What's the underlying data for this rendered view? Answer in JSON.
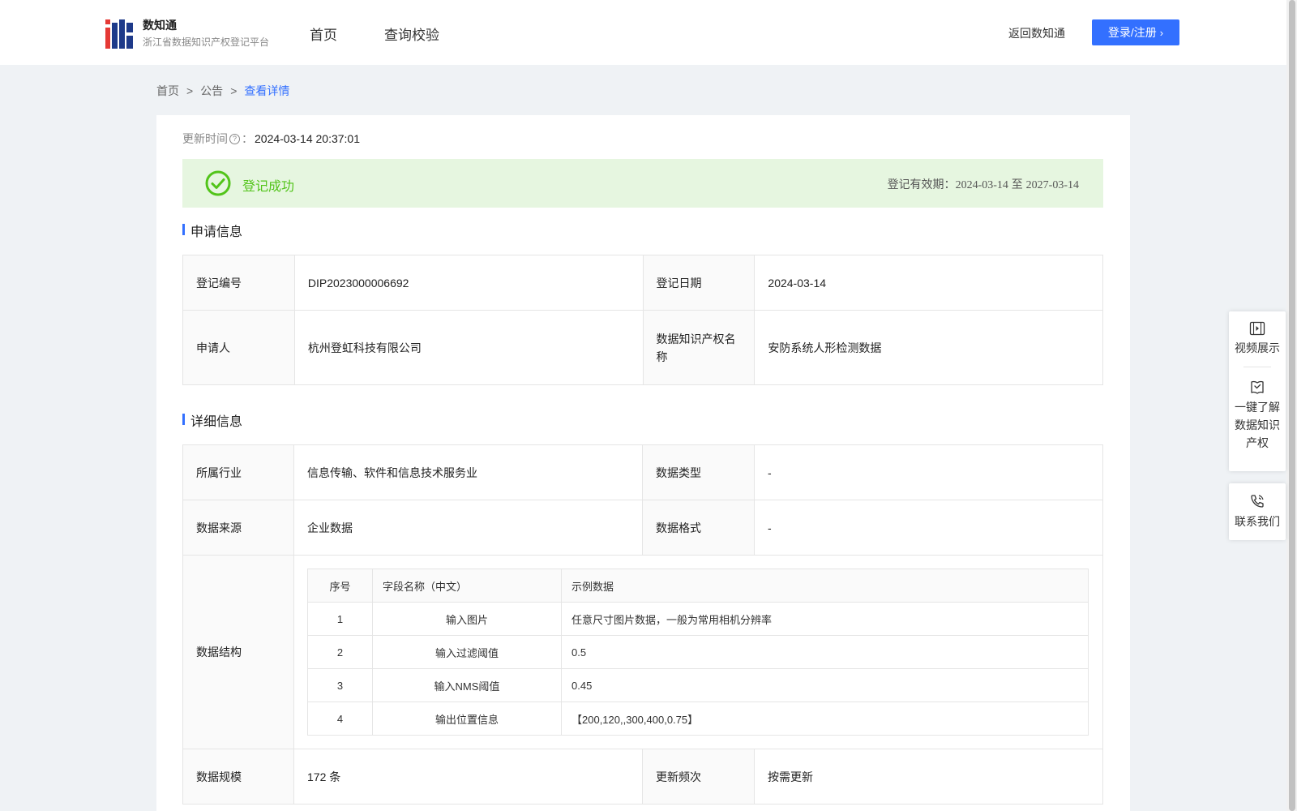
{
  "brand": {
    "name": "数知通",
    "subtitle": "浙江省数据知识产权登记平台"
  },
  "nav": [
    {
      "label": "首页"
    },
    {
      "label": "查询校验"
    }
  ],
  "header_actions": {
    "back_label": "返回数知通",
    "login_label": "登录/注册"
  },
  "breadcrumb": {
    "home": "首页",
    "notice": "公告",
    "current": "查看详情",
    "separator": ">"
  },
  "update": {
    "label": "更新时间",
    "colon": "：",
    "value": "2024-03-14 20:37:01"
  },
  "status": {
    "text": "登记成功",
    "validity_label": "登记有效期：",
    "valid_from": "2024-03-14",
    "to": "至",
    "valid_to": "2027-03-14",
    "color": "#52c41a"
  },
  "application": {
    "title": "申请信息",
    "reg_no_label": "登记编号",
    "reg_no": "DIP2023000006692",
    "reg_date_label": "登记日期",
    "reg_date": "2024-03-14",
    "applicant_label": "申请人",
    "applicant": "杭州登虹科技有限公司",
    "ip_name_label": "数据知识产权名称",
    "ip_name": "安防系统人形检测数据"
  },
  "detail": {
    "title": "详细信息",
    "industry_label": "所属行业",
    "industry": "信息传输、软件和信息技术服务业",
    "data_type_label": "数据类型",
    "data_type": "-",
    "source_label": "数据来源",
    "source": "企业数据",
    "format_label": "数据格式",
    "format": "-",
    "structure_label": "数据结构",
    "structure_headers": {
      "no": "序号",
      "name": "字段名称（中文）",
      "sample": "示例数据"
    },
    "structure_rows": [
      {
        "no": "1",
        "name": "输入图片",
        "sample": "任意尺寸图片数据，一般为常用相机分辨率"
      },
      {
        "no": "2",
        "name": "输入过滤阈值",
        "sample": "0.5"
      },
      {
        "no": "3",
        "name": "输入NMS阈值",
        "sample": "0.45"
      },
      {
        "no": "4",
        "name": "输出位置信息",
        "sample": "【200,120,,300,400,0.75】"
      }
    ],
    "scale_label": "数据规模",
    "scale": "172 条",
    "frequency_label": "更新频次",
    "frequency": "按需更新"
  },
  "float_panel": {
    "video": "视频展示",
    "learn": "一键了解数据知识产权",
    "contact": "联系我们"
  },
  "colors": {
    "accent": "#3370ff",
    "success": "#52c41a",
    "success_bg": "#e6f6e0"
  },
  "icons": [
    "logo-icon",
    "question-icon",
    "check-circle-icon",
    "video-icon",
    "book-icon",
    "phone-icon",
    "chevron-right-icon"
  ]
}
